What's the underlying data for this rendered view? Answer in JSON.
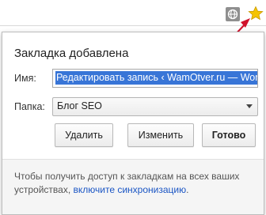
{
  "bubble": {
    "title": "Закладка добавлена",
    "name_label": "Имя:",
    "name_value": "Редактировать запись ‹ WamOtver.ru — WordPress",
    "folder_label": "Папка:",
    "folder_value": "Блог SEO",
    "delete_button": "Удалить",
    "edit_button": "Изменить",
    "done_button": "Готово",
    "footer_text": "Чтобы получить доступ к закладкам на всех ваших устройствах, ",
    "footer_link": "включите синхронизацию",
    "footer_end": "."
  },
  "icons": {
    "extension": "globe-icon",
    "bookmark": "star-icon"
  },
  "colors": {
    "star": "#f5c400",
    "arrow": "#d0112b",
    "selection": "#3875d7",
    "link": "#1a55c4"
  }
}
